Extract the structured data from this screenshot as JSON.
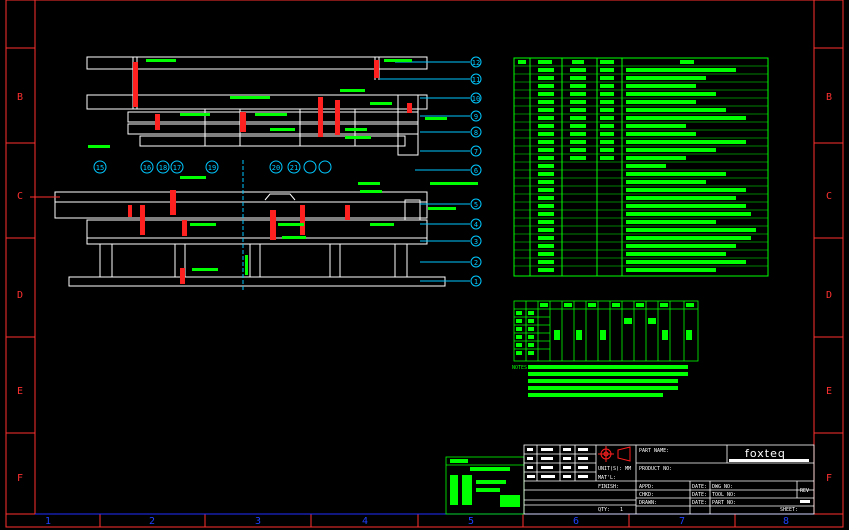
{
  "frame": {
    "row_labels": [
      "B",
      "C",
      "D",
      "E",
      "F"
    ],
    "col_labels": [
      "1",
      "2",
      "3",
      "4",
      "5",
      "6",
      "7",
      "8"
    ]
  },
  "callouts": [
    "12",
    "11",
    "10",
    "9",
    "8",
    "7",
    "6",
    "5",
    "4",
    "3",
    "2",
    "1"
  ],
  "top_callouts": [
    "15",
    "16",
    "18",
    "17",
    "19",
    "20",
    "21"
  ],
  "title_block": {
    "company": "foxteq",
    "part_name_label": "PART NAME:",
    "product_no_label": "PRODUCT NO:",
    "unit_label": "UNIT(S): MM",
    "matl_label": "MAT'L:",
    "finish_label": "FINISH:",
    "qty_label": "QTY:",
    "qty_value": "1",
    "appd_label": "APPD:",
    "chkd_label": "CHKD:",
    "drawn_label": "DRAWN:",
    "date_label": "DATE:",
    "dwg_no_label": "DWG NO:",
    "tool_no_label": "TOOL NO:",
    "part_no_label": "PART NO:",
    "rev_label": "REV",
    "sheet_label": "SHEET:",
    "notes_label": "NOTES:"
  },
  "colors": {
    "frame": "#ff3030",
    "lines": "#ffffff",
    "green": "#00ff00",
    "cyan": "#00c8ff",
    "red": "#ff2020",
    "yellow": "#ffff00"
  }
}
